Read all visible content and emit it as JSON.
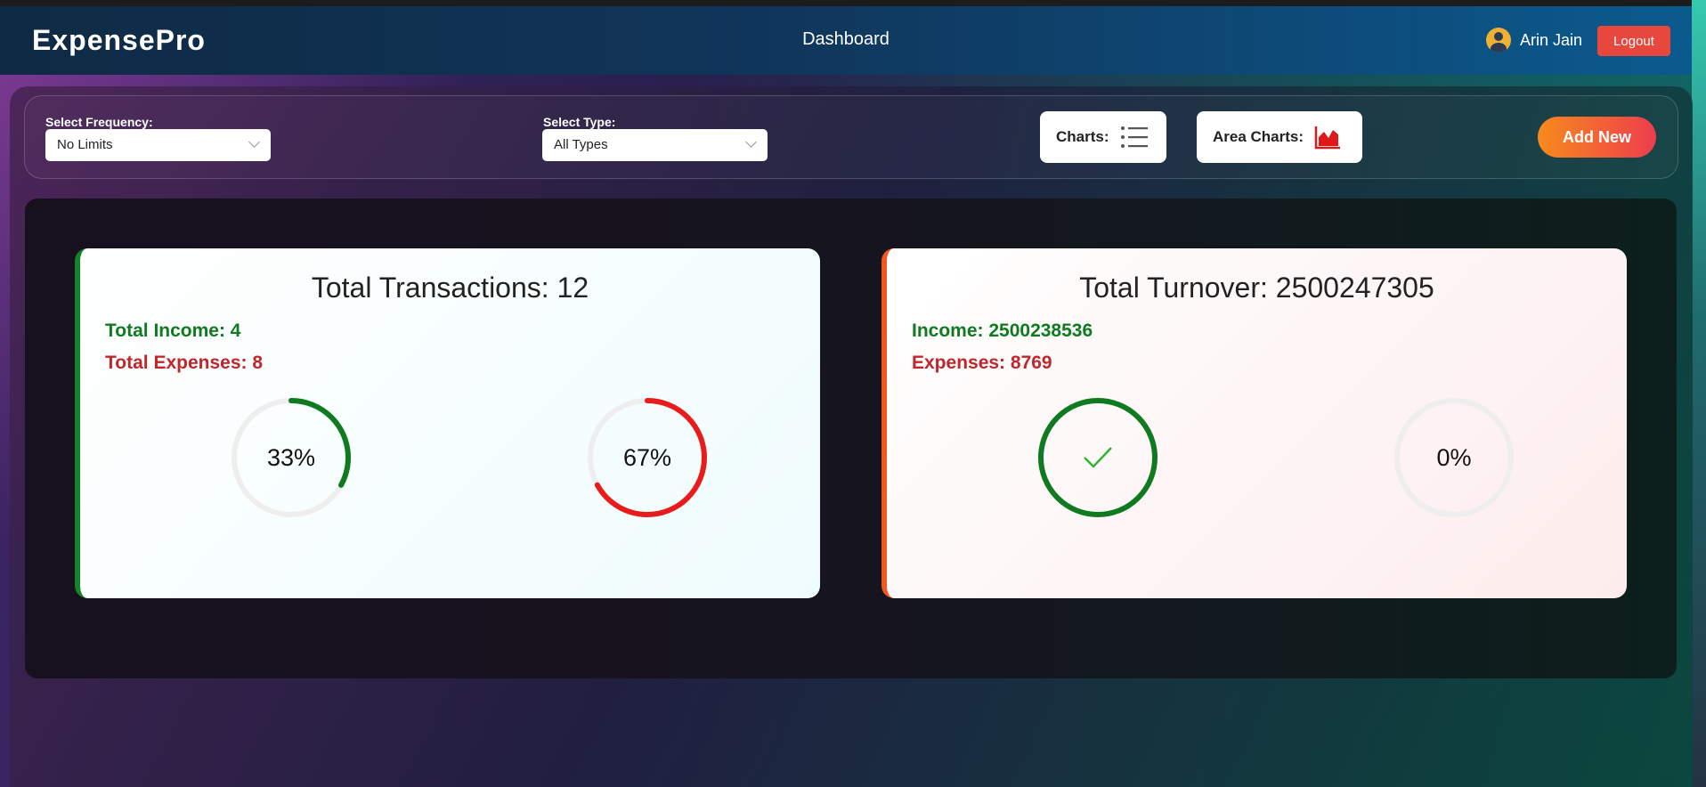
{
  "header": {
    "brand": "ExpensePro",
    "nav_title": "Dashboard",
    "user_name": "Arin Jain",
    "logout_label": "Logout"
  },
  "filters": {
    "frequency_label": "Select Frequency:",
    "frequency_value": "No Limits",
    "type_label": "Select Type:",
    "type_value": "All Types",
    "charts_label": "Charts:",
    "area_charts_label": "Area Charts:",
    "add_new_label": "Add New"
  },
  "transactions_card": {
    "title": "Total Transactions: 12",
    "income": "Total Income: 4",
    "expenses": "Total Expenses: 8",
    "income_percent": 33,
    "income_percent_label": "33%",
    "expense_percent": 67,
    "expense_percent_label": "67%"
  },
  "turnover_card": {
    "title": "Total Turnover: 2500247305",
    "income": "Income: 2500238536",
    "expenses": "Expenses: 8769",
    "income_percent": 100,
    "expense_percent": 0,
    "expense_percent_label": "0%"
  },
  "colors": {
    "income": "#0f7a1f",
    "expense": "#e81c1c",
    "ring_track": "#eeeeee",
    "logout": "#e8473d"
  }
}
